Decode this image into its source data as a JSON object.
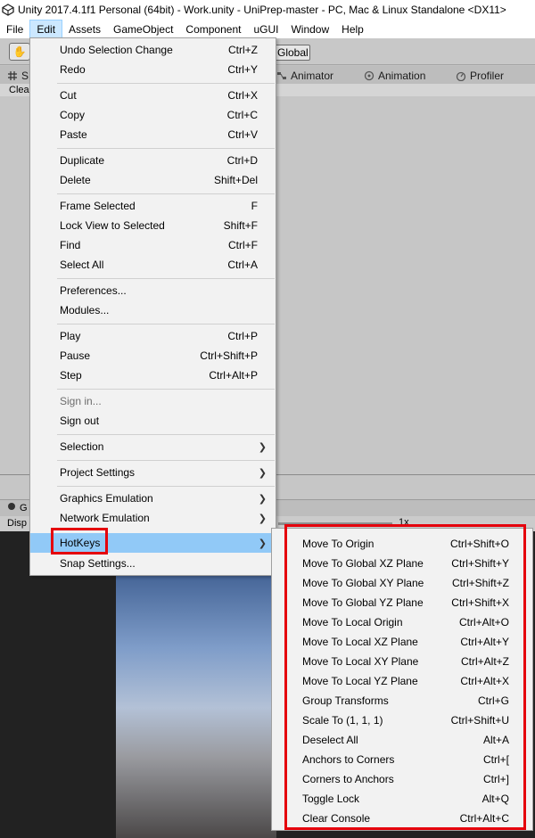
{
  "window": {
    "title": "Unity 2017.4.1f1 Personal (64bit) - Work.unity - UniPrep-master - PC, Mac & Linux Standalone <DX11>"
  },
  "menubar": {
    "items": [
      "File",
      "Edit",
      "Assets",
      "GameObject",
      "Component",
      "uGUI",
      "Window",
      "Help"
    ],
    "active": "Edit"
  },
  "toolbar": {
    "global_label": "Global"
  },
  "tabs": {
    "scene_fragment": "S",
    "animator": "Animator",
    "animation": "Animation",
    "profiler": "Profiler"
  },
  "scene": {
    "clear_fragment": "Clea"
  },
  "game": {
    "tab_fragment": "G",
    "display_fragment": "Disp",
    "scale_label": "1x"
  },
  "edit_menu": {
    "items": [
      {
        "label": "Undo Selection Change",
        "shortcut": "Ctrl+Z"
      },
      {
        "label": "Redo",
        "shortcut": "Ctrl+Y"
      },
      {
        "label": "Cut",
        "shortcut": "Ctrl+X"
      },
      {
        "label": "Copy",
        "shortcut": "Ctrl+C"
      },
      {
        "label": "Paste",
        "shortcut": "Ctrl+V"
      },
      {
        "label": "Duplicate",
        "shortcut": "Ctrl+D"
      },
      {
        "label": "Delete",
        "shortcut": "Shift+Del"
      },
      {
        "label": "Frame Selected",
        "shortcut": "F"
      },
      {
        "label": "Lock View to Selected",
        "shortcut": "Shift+F"
      },
      {
        "label": "Find",
        "shortcut": "Ctrl+F"
      },
      {
        "label": "Select All",
        "shortcut": "Ctrl+A"
      },
      {
        "label": "Preferences...",
        "shortcut": ""
      },
      {
        "label": "Modules...",
        "shortcut": ""
      },
      {
        "label": "Play",
        "shortcut": "Ctrl+P"
      },
      {
        "label": "Pause",
        "shortcut": "Ctrl+Shift+P"
      },
      {
        "label": "Step",
        "shortcut": "Ctrl+Alt+P"
      },
      {
        "label": "Sign in...",
        "shortcut": ""
      },
      {
        "label": "Sign out",
        "shortcut": ""
      },
      {
        "label": "Selection",
        "shortcut": ""
      },
      {
        "label": "Project Settings",
        "shortcut": ""
      },
      {
        "label": "Graphics Emulation",
        "shortcut": ""
      },
      {
        "label": "Network Emulation",
        "shortcut": ""
      },
      {
        "label": "HotKeys",
        "shortcut": ""
      },
      {
        "label": "Snap Settings...",
        "shortcut": ""
      }
    ]
  },
  "hotkeys_menu": {
    "items": [
      {
        "label": "Move To Origin",
        "shortcut": "Ctrl+Shift+O"
      },
      {
        "label": "Move To Global XZ Plane",
        "shortcut": "Ctrl+Shift+Y"
      },
      {
        "label": "Move To Global XY Plane",
        "shortcut": "Ctrl+Shift+Z"
      },
      {
        "label": "Move To Global YZ Plane",
        "shortcut": "Ctrl+Shift+X"
      },
      {
        "label": "Move To Local Origin",
        "shortcut": "Ctrl+Alt+O"
      },
      {
        "label": "Move To Local XZ Plane",
        "shortcut": "Ctrl+Alt+Y"
      },
      {
        "label": "Move To Local XY Plane",
        "shortcut": "Ctrl+Alt+Z"
      },
      {
        "label": "Move To Local YZ Plane",
        "shortcut": "Ctrl+Alt+X"
      },
      {
        "label": "Group Transforms",
        "shortcut": "Ctrl+G"
      },
      {
        "label": "Scale To (1, 1, 1)",
        "shortcut": "Ctrl+Shift+U"
      },
      {
        "label": "Deselect All",
        "shortcut": "Alt+A"
      },
      {
        "label": "Anchors to Corners",
        "shortcut": "Ctrl+["
      },
      {
        "label": "Corners to Anchors",
        "shortcut": "Ctrl+]"
      },
      {
        "label": "Toggle Lock",
        "shortcut": "Alt+Q"
      },
      {
        "label": "Clear Console",
        "shortcut": "Ctrl+Alt+C"
      }
    ]
  },
  "colors": {
    "highlight": "#91c9f7",
    "annotation_red": "#e5000c",
    "menu_bg": "#f2f2f2"
  }
}
